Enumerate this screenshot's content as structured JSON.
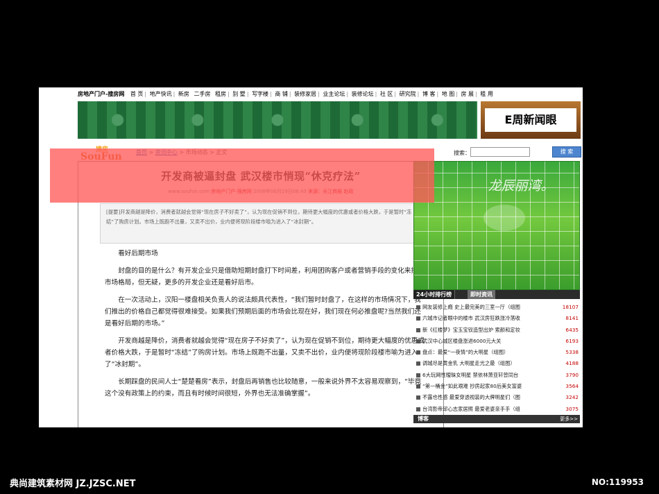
{
  "topnav": {
    "brand": "房地产门户-搜房网",
    "items": [
      "首 页",
      "地产快讯",
      "新房",
      "二手房",
      "租房",
      "别 墅",
      "写字楼",
      "商 铺",
      "装修家居",
      "业主论坛",
      "装修论坛",
      "社 区",
      "研究院",
      "博 客",
      "地 图",
      "房 展",
      "租 用"
    ]
  },
  "banner": {
    "badge_text": "E周新闻眼"
  },
  "logo": {
    "top_text": "搜房",
    "main_text": "SouFun"
  },
  "breadcrumb": {
    "home": "首页",
    "sep1": ">",
    "news": "资讯中心",
    "sep2": ">",
    "market": "市场动态",
    "sep3": ">",
    "current": "正文"
  },
  "search": {
    "label": "搜索：",
    "button": "搜 索"
  },
  "article": {
    "title": "开发商被逼封盘  武汉楼市悄现“休克疗法”",
    "meta_site": "www.soufun.com",
    "meta_portal": "房地产门户-搜房网",
    "meta_date": "2008年06月19日06:43",
    "meta_source": "来源：长江商报",
    "meta_author": "赵政",
    "summary": "[提要]开发商越是降价，消费者就越会觉得“现在房子不好卖了”，认为现在促销不到位，期待更大幅度的优惠或者价格大跌，于是暂时“冻结”了购房计划。市场上既跑不出量，又卖不出价，业内便将现阶段楼市喻为进入了“冰封期”。",
    "subhead": "看好后期市场",
    "p1": "封盘的目的是什么？有开发企业只是借助短期封盘打下时间差，利用团购客户或者营销手段的变化来扭转市场格局，但无疑，更多的开发企业还是看好后市。",
    "p2": "在一次活动上，汉阳一楼盘相关负责人的说法颇具代表性，“我们暂时封盘了，在这样的市场情况下，我们推出的价格自己都觉得很难接受。如果我们预期后面的市场会比现在好，我们现在何必推盘呢?当然我们还是看好后期的市场。”",
    "p3": "开发商越是降价，消费者就越会觉得“现在房子不好卖了”，认为现在促销不到位，期待更大幅度的优惠或者价格大跌，于是暂时“冻结”了购房计划。市场上既跑不出量，又卖不出价，业内便将现阶段楼市喻为进入了“冰封期”。",
    "p4": "长期踩盘的民间人士“楚楚看房”表示，封盘后再销售也比较随意，一般来说外界不太容易观察到，“毕竟这个没有政策上的约束，而且有时候时间很短，外界也无法准确掌握”。"
  },
  "sidebar": {
    "ad_text": "龙辰丽湾。",
    "tab_active": "24小时排行榜",
    "tab_inactive": "即时资讯",
    "ranking": [
      {
        "title": "网友装修上瘾  史上最完美的三室一厅（组图",
        "count": "18107"
      },
      {
        "title": "六城市记者眼中的楼市  武汉房狂跌涨冷落收",
        "count": "8141"
      },
      {
        "title": "新《红楼梦》宝玉宝钗造型出炉  索颜和定妆",
        "count": "6435"
      },
      {
        "title": "武汉中心城区楼盘涨进6000元大关",
        "count": "6193"
      },
      {
        "title": "盘点：最爱“一夜情”的大明星（组图）",
        "count": "5338"
      },
      {
        "title": "调城尽是黄金乳  大明星走光之最（组图）",
        "count": "4188"
      },
      {
        "title": "6大玩网性暧昧女明星  禁依林萧亚轩曾同台",
        "count": "3790"
      },
      {
        "title": "“第一桶金”如此艰难  抄房起家80后美女富婆",
        "count": "3564"
      },
      {
        "title": "不露也性感  最爱穿透视装的大牌明星们（图",
        "count": "3242"
      },
      {
        "title": "台湾影帝邱心志家居照  最爱老婆亲手手（组",
        "count": "3075"
      }
    ],
    "blog_label": "博客",
    "blog_more": "更多>>"
  },
  "footer": {
    "left": "典尚建筑素材网 JZ.JZSC.NET",
    "right": "NO:119953"
  }
}
